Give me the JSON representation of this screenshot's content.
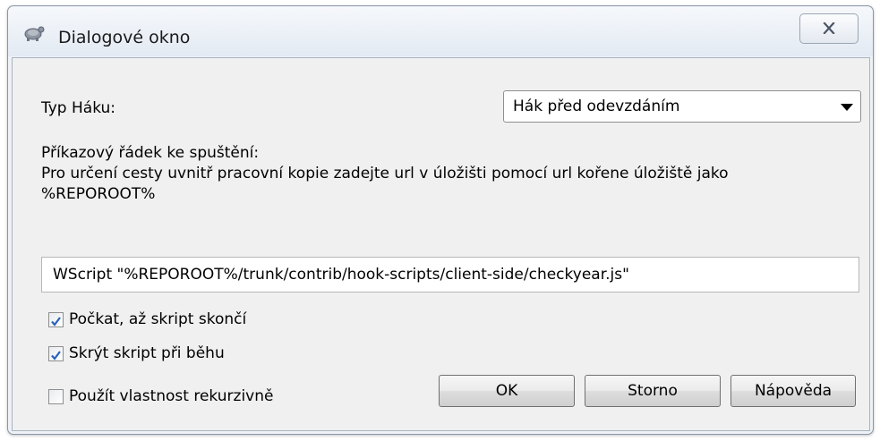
{
  "window": {
    "title": "Dialogové okno"
  },
  "icons": {
    "app": "tortoise-icon",
    "close": "close-icon",
    "dropdown": "chevron-down-icon",
    "checkmark": "checkmark-icon"
  },
  "form": {
    "hook_type_label": "Typ Háku:",
    "hook_type_value": "Hák před odevzdáním",
    "command_label": "Příkazový řádek ke spuštění:",
    "command_hint_line1": "Pro určení cesty uvnitř pracovní kopie zadejte url v úložišti pomocí url kořene úložiště jako",
    "command_hint_line2": "%REPOROOT%",
    "command_value": "WScript \"%REPOROOT%/trunk/contrib/hook-scripts/client-side/checkyear.js\""
  },
  "checkboxes": [
    {
      "label": "Počkat, až skript skončí",
      "checked": true
    },
    {
      "label": "Skrýt skript při běhu",
      "checked": true
    },
    {
      "label": "Použít vlastnost rekurzivně",
      "checked": false
    }
  ],
  "buttons": {
    "ok": "OK",
    "cancel": "Storno",
    "help": "Nápověda"
  },
  "colors": {
    "titlebar": "#e3eaf3",
    "client": "#f0f0f0",
    "check_accent": "#2a62b8"
  }
}
